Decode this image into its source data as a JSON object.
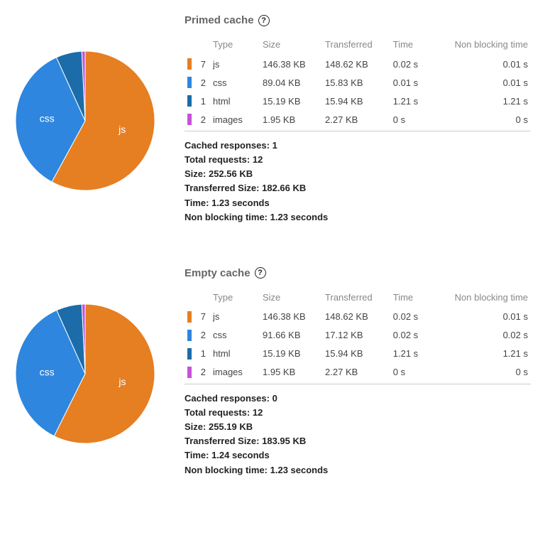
{
  "colors": {
    "js": "#e67e22",
    "css": "#2e86de",
    "html": "#1b6ca8",
    "images": "#c552d9"
  },
  "headers": {
    "type": "Type",
    "size": "Size",
    "transferred": "Transferred",
    "time": "Time",
    "nonblocking": "Non blocking time"
  },
  "summary_labels": {
    "cached": "Cached responses:",
    "total": "Total requests:",
    "size": "Size:",
    "transferred": "Transferred Size:",
    "time": "Time:",
    "nonblocking": "Non blocking time:"
  },
  "sections": [
    {
      "title": "Primed cache",
      "rows": [
        {
          "count": 7,
          "type": "js",
          "size": "146.38 KB",
          "transferred": "148.62 KB",
          "time": "0.02 s",
          "nonblocking": "0.01 s",
          "color": "#e67e22"
        },
        {
          "count": 2,
          "type": "css",
          "size": "89.04 KB",
          "transferred": "15.83 KB",
          "time": "0.01 s",
          "nonblocking": "0.01 s",
          "color": "#2e86de"
        },
        {
          "count": 1,
          "type": "html",
          "size": "15.19 KB",
          "transferred": "15.94 KB",
          "time": "1.21 s",
          "nonblocking": "1.21 s",
          "color": "#1b6ca8"
        },
        {
          "count": 2,
          "type": "images",
          "size": "1.95 KB",
          "transferred": "2.27 KB",
          "time": "0 s",
          "nonblocking": "0 s",
          "color": "#c552d9"
        }
      ],
      "summary": {
        "cached": "1",
        "total": "12",
        "size": "252.56 KB",
        "transferred": "182.66 KB",
        "time": "1.23 seconds",
        "nonblocking": "1.23 seconds"
      }
    },
    {
      "title": "Empty cache",
      "rows": [
        {
          "count": 7,
          "type": "js",
          "size": "146.38 KB",
          "transferred": "148.62 KB",
          "time": "0.02 s",
          "nonblocking": "0.01 s",
          "color": "#e67e22"
        },
        {
          "count": 2,
          "type": "css",
          "size": "91.66 KB",
          "transferred": "17.12 KB",
          "time": "0.02 s",
          "nonblocking": "0.02 s",
          "color": "#2e86de"
        },
        {
          "count": 1,
          "type": "html",
          "size": "15.19 KB",
          "transferred": "15.94 KB",
          "time": "1.21 s",
          "nonblocking": "1.21 s",
          "color": "#1b6ca8"
        },
        {
          "count": 2,
          "type": "images",
          "size": "1.95 KB",
          "transferred": "2.27 KB",
          "time": "0 s",
          "nonblocking": "0 s",
          "color": "#c552d9"
        }
      ],
      "summary": {
        "cached": "0",
        "total": "12",
        "size": "255.19 KB",
        "transferred": "183.95 KB",
        "time": "1.24 seconds",
        "nonblocking": "1.23 seconds"
      }
    }
  ],
  "chart_data": [
    {
      "type": "pie",
      "title": "Primed cache — asset size breakdown (KB)",
      "series": [
        {
          "name": "js",
          "value": 146.38,
          "color": "#e67e22"
        },
        {
          "name": "css",
          "value": 89.04,
          "color": "#2e86de"
        },
        {
          "name": "html",
          "value": 15.19,
          "color": "#1b6ca8"
        },
        {
          "name": "images",
          "value": 1.95,
          "color": "#c552d9"
        }
      ],
      "labels_shown": [
        "js",
        "css"
      ]
    },
    {
      "type": "pie",
      "title": "Empty cache — asset size breakdown (KB)",
      "series": [
        {
          "name": "js",
          "value": 146.38,
          "color": "#e67e22"
        },
        {
          "name": "css",
          "value": 91.66,
          "color": "#2e86de"
        },
        {
          "name": "html",
          "value": 15.19,
          "color": "#1b6ca8"
        },
        {
          "name": "images",
          "value": 1.95,
          "color": "#c552d9"
        }
      ],
      "labels_shown": [
        "js",
        "css"
      ]
    }
  ]
}
